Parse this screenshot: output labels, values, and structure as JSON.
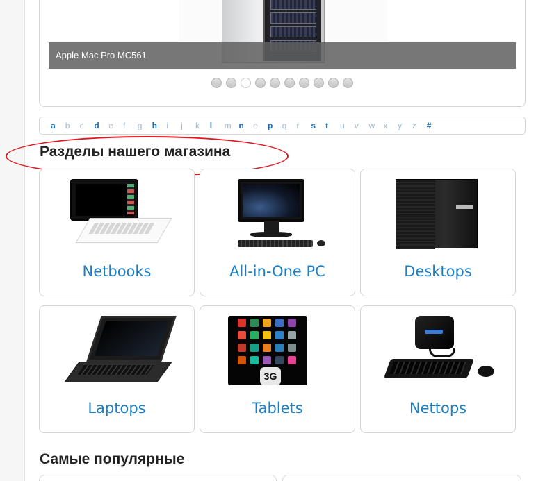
{
  "slider": {
    "caption": "Apple Mac Pro MC561",
    "dots_count": 10,
    "active_dot_index": 2
  },
  "alphabet": {
    "letters": [
      {
        "ch": "a",
        "on": true
      },
      {
        "ch": "b",
        "on": false
      },
      {
        "ch": "c",
        "on": false
      },
      {
        "ch": "d",
        "on": true
      },
      {
        "ch": "e",
        "on": false
      },
      {
        "ch": "f",
        "on": false
      },
      {
        "ch": "g",
        "on": false
      },
      {
        "ch": "h",
        "on": true
      },
      {
        "ch": "i",
        "on": false
      },
      {
        "ch": "j",
        "on": false
      },
      {
        "ch": "k",
        "on": false
      },
      {
        "ch": "l",
        "on": true
      },
      {
        "ch": "m",
        "on": false
      },
      {
        "ch": "n",
        "on": true
      },
      {
        "ch": "o",
        "on": false
      },
      {
        "ch": "p",
        "on": true
      },
      {
        "ch": "q",
        "on": false
      },
      {
        "ch": "r",
        "on": false
      },
      {
        "ch": "s",
        "on": true
      },
      {
        "ch": "t",
        "on": true
      },
      {
        "ch": "u",
        "on": false
      },
      {
        "ch": "v",
        "on": false
      },
      {
        "ch": "w",
        "on": false
      },
      {
        "ch": "x",
        "on": false
      },
      {
        "ch": "y",
        "on": false
      },
      {
        "ch": "z",
        "on": false
      },
      {
        "ch": "#",
        "on": true
      }
    ]
  },
  "sections": {
    "title": "Разделы нашего магазина",
    "categories": [
      {
        "label": "Netbooks",
        "icon": "netbook-image"
      },
      {
        "label": "All-in-One PC",
        "icon": "all-in-one-pc-image"
      },
      {
        "label": "Desktops",
        "icon": "desktop-tower-image"
      },
      {
        "label": "Laptops",
        "icon": "laptop-image"
      },
      {
        "label": "Tablets",
        "icon": "tablet-image"
      },
      {
        "label": "Nettops",
        "icon": "nettop-image"
      }
    ]
  },
  "popular": {
    "title": "Самые популярные"
  },
  "colors": {
    "link_blue": "#1d7ec2",
    "highlight_red": "#e0161e",
    "border_gray": "#d4d4d4"
  }
}
